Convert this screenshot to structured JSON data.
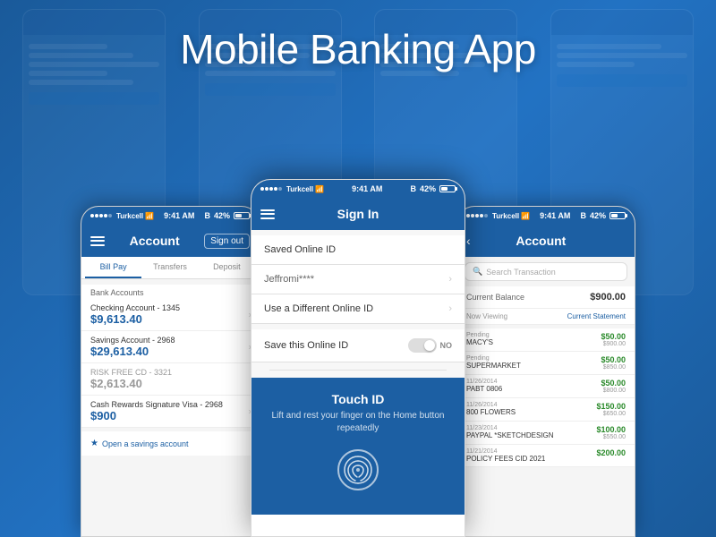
{
  "page": {
    "title": "Mobile Banking App",
    "background_color": "#1c5fa3"
  },
  "header": {
    "title": "Mobile Banking App"
  },
  "phones": {
    "left": {
      "status": {
        "carrier": "Turkcell",
        "time": "9:41 AM",
        "battery": "42%"
      },
      "navbar": {
        "title": "Account",
        "signout": "Sign out"
      },
      "tabs": [
        "Bill Pay",
        "Transfers",
        "Deposit"
      ],
      "section_title": "Bank Accounts",
      "accounts": [
        {
          "name": "Checking Account - 1345",
          "balance": "$9,613.40",
          "greyed": false
        },
        {
          "name": "Savings Account - 2968",
          "balance": "$29,613.40",
          "greyed": false
        },
        {
          "name": "RISK FREE CD - 3321",
          "balance": "$2,613.40",
          "greyed": true
        },
        {
          "name": "Cash Rewards Signature Visa - 2968",
          "balance": "$900",
          "greyed": false
        }
      ],
      "cta": "Open a savings account"
    },
    "middle": {
      "status": {
        "carrier": "Turkcell",
        "time": "9:41 AM",
        "battery": "42%"
      },
      "navbar": {
        "title": "Sign In"
      },
      "saved_id_label": "Saved Online ID",
      "saved_id_value": "Jeffromi****",
      "different_id_label": "Use a Different Online ID",
      "save_id_label": "Save this Online ID",
      "toggle_state": "NO",
      "touchid": {
        "title": "Touch ID",
        "subtitle": "Lift and rest your finger on the Home button repeatedly"
      }
    },
    "right": {
      "status": {
        "carrier": "Turkcell",
        "time": "9:41 AM",
        "battery": "42%"
      },
      "navbar": {
        "title": "Account"
      },
      "search_placeholder": "Search Transaction",
      "balance_label": "Current Balance",
      "balance_amount": "$900.00",
      "viewing_label": "Now Viewing",
      "viewing_value": "Current Statement",
      "transactions": [
        {
          "status": "Pending",
          "name": "MACY'S",
          "amount": "$50.00",
          "balance": "$900.00",
          "date": ""
        },
        {
          "status": "Pending",
          "name": "SUPERMARKET",
          "amount": "$50.00",
          "balance": "$850.00",
          "date": ""
        },
        {
          "status": "11/26/2014",
          "name": "PABT 0806",
          "amount": "$50.00",
          "balance": "$800.00",
          "date": "11/26/2014"
        },
        {
          "status": "11/26/2014",
          "name": "800 FLOWERS",
          "amount": "$150.00",
          "balance": "$650.00",
          "date": "11/26/2014"
        },
        {
          "status": "11/23/2014",
          "name": "PAYPAL *SKETCHDESIGN",
          "amount": "$100.00",
          "balance": "$550.00",
          "date": "11/23/2014"
        },
        {
          "status": "11/21/2014",
          "name": "POLICY FEES CID 2021",
          "amount": "$200.00",
          "balance": "",
          "date": ""
        }
      ]
    }
  }
}
